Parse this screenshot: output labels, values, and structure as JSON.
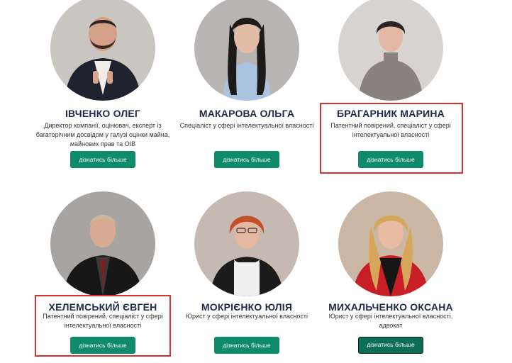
{
  "team": [
    {
      "name": "ІВЧЕНКО ОЛЕГ",
      "description": "Директор компанії, оцінювач, експерт із багаторічним досвідом у галузі оцінки майна, майнових прав та ОІВ",
      "button_label": "дізнатись більше"
    },
    {
      "name": "МАКАРОВА ОЛЬГА",
      "description": "Спеціаліст у сфері інтелектуальної власності",
      "button_label": "дізнатись більше"
    },
    {
      "name": "БРАГАРНИК МАРИНА",
      "description": "Патентний повірений, спеціаліст у сфері інтелектуальної власності",
      "button_label": "дізнатись більше"
    },
    {
      "name": "ХЕЛЕМСЬКИЙ ЄВГЕН",
      "description": "Патентний повірений, спеціаліст у сфері інтелектуальної власності",
      "button_label": "дізнатись більше"
    },
    {
      "name": "МОКРІЄНКО ЮЛІЯ",
      "description": "Юрист у сфері інтелектуальної власності",
      "button_label": "дізнатись більше"
    },
    {
      "name": "МИХАЛЬЧЕНКО ОКСАНА",
      "description": "Юрист у сфері інтелектуальної власності, адвокат",
      "button_label": "дізнатись більше"
    }
  ],
  "colors": {
    "button": "#0f8a6b",
    "name_text": "#1b2b4a",
    "highlight": "#d93030"
  }
}
